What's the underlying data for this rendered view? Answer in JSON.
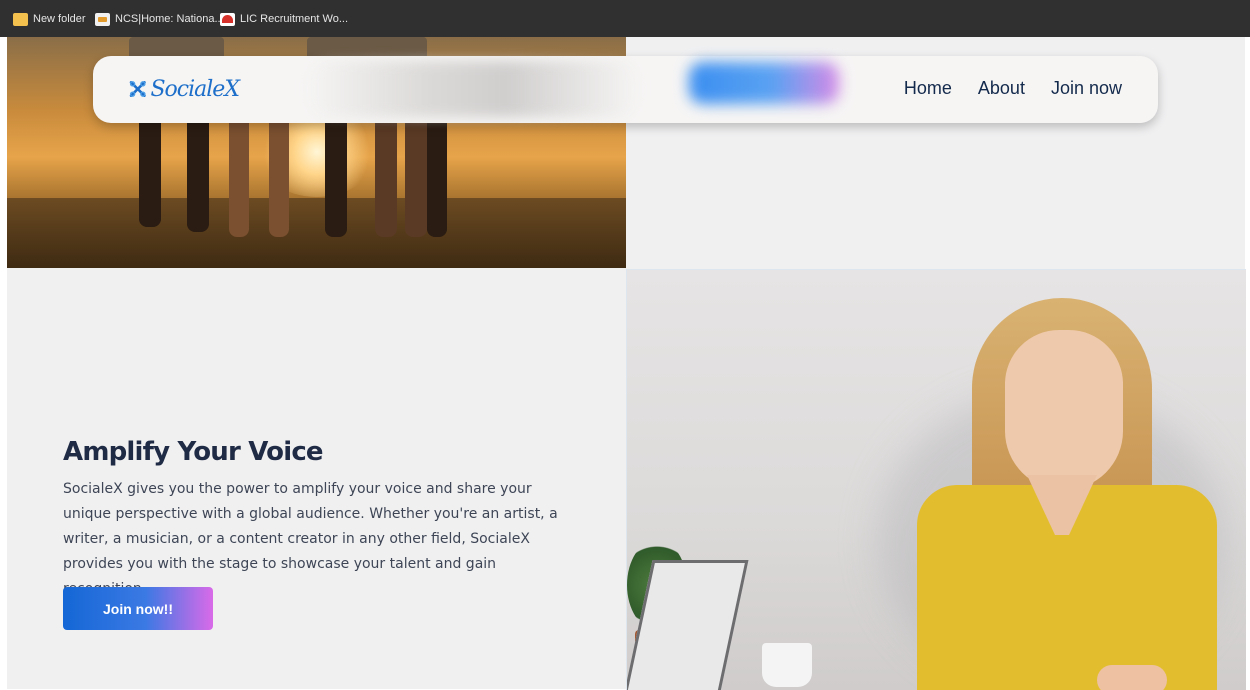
{
  "bookmarks": [
    {
      "label": "New folder",
      "icon": "folder-icon"
    },
    {
      "label": "NCS|Home: Nationa...",
      "icon": "ncs-favicon"
    },
    {
      "label": "LIC Recruitment Wo...",
      "icon": "lic-favicon"
    }
  ],
  "navbar": {
    "logo_text": "SocialeX",
    "links": [
      "Home",
      "About",
      "Join now"
    ]
  },
  "section": {
    "heading": "Amplify Your Voice",
    "body": "SocialeX gives you the power to amplify your voice and share your unique perspective with a global audience. Whether you're an artist, a writer, a musician, or a content creator in any other field, SocialeX provides you with the stage to showcase your talent and gain recognition.",
    "cta_label": "Join now!!"
  },
  "colors": {
    "brand_blue": "#1e6fc9",
    "nav_text": "#142a4c",
    "cta_gradient_start": "#1467d6",
    "cta_gradient_end": "#d96ae8",
    "page_background": "#f0f0f1"
  }
}
